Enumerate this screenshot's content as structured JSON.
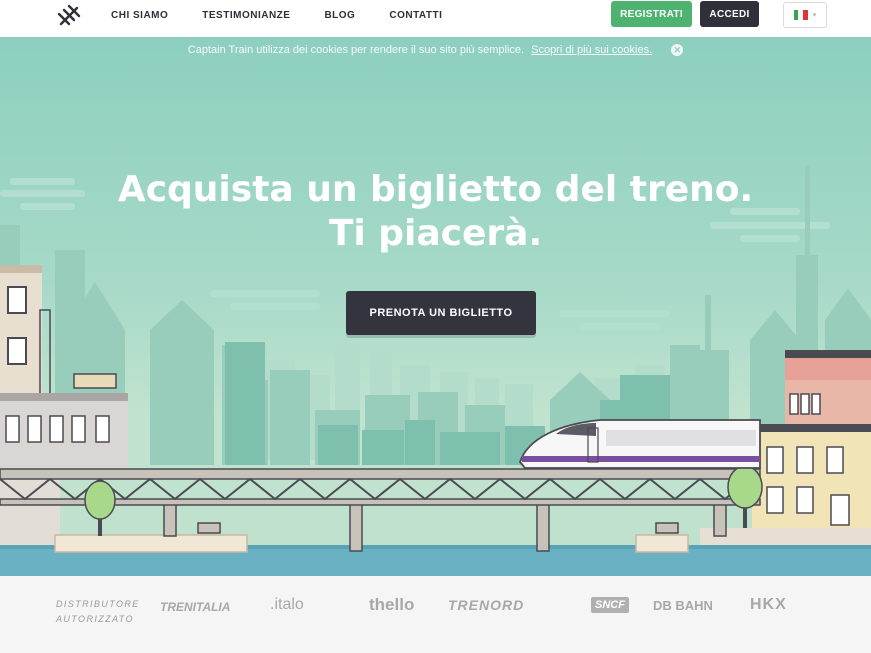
{
  "nav": {
    "links": [
      "CHI SIAMO",
      "TESTIMONIANZE",
      "BLOG",
      "CONTATTI"
    ],
    "register_label": "REGISTRATI",
    "login_label": "ACCEDI",
    "language_flag": "italy-flag-icon"
  },
  "cookie_bar": {
    "text": "Captain Train utilizza dei cookies per rendere il suo sito più semplice.",
    "link": "Scopri di più sui cookies."
  },
  "hero": {
    "headline_line1": "Acquista un biglietto del treno.",
    "headline_line2": "Ti piacerà.",
    "cta_label": "PRENOTA UN BIGLIETTO"
  },
  "partners": {
    "label_line1": "DISTRIBUTORE",
    "label_line2": "AUTORIZZATO",
    "logos": [
      "TRENITALIA",
      ".italo",
      "thello",
      "TRENORD",
      "SNCF",
      "DB BAHN",
      "HKX"
    ]
  },
  "colors": {
    "accent_green": "#4db36e",
    "dark": "#2f3039",
    "sky": "#8dcfbf"
  }
}
